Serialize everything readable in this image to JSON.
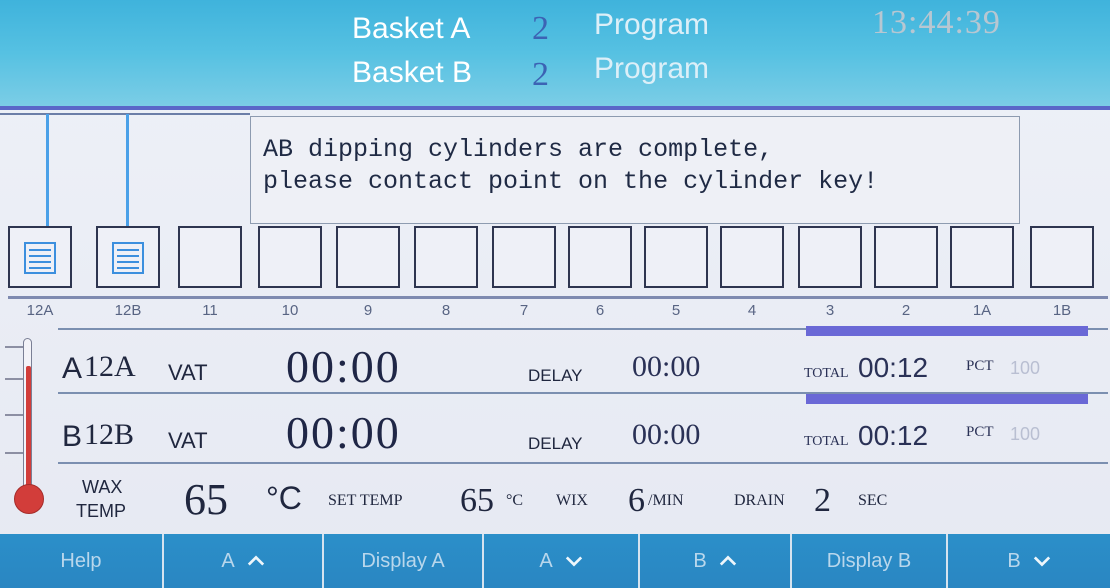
{
  "header": {
    "basket_a_label": "Basket A",
    "basket_a_num": "2",
    "basket_b_label": "Basket B",
    "basket_b_num": "2",
    "program_label": "Program",
    "time": "13:44:39"
  },
  "message": {
    "line1": "AB dipping cylinders are complete,",
    "line2": "please contact point on the cylinder key!"
  },
  "tanks": [
    "12A",
    "12B",
    "11",
    "10",
    "9",
    "8",
    "7",
    "6",
    "5",
    "4",
    "3",
    "2",
    "1A",
    "1B"
  ],
  "row_a": {
    "letter": "A",
    "id": "12A",
    "vat": "VAT",
    "time": "00:00",
    "delay_label": "DELAY",
    "delay": "00:00",
    "total_label": "TOTAL",
    "total": "00:12",
    "pct_label": "PCT",
    "pct": "100"
  },
  "row_b": {
    "letter": "B",
    "id": "12B",
    "vat": "VAT",
    "time": "00:00",
    "delay_label": "DELAY",
    "delay": "00:00",
    "total_label": "TOTAL",
    "total": "00:12",
    "pct_label": "PCT",
    "pct": "100"
  },
  "wax": {
    "label1": "WAX",
    "label2": "TEMP",
    "temp": "65",
    "temp_unit": "°C",
    "set_label": "SET TEMP",
    "set_temp": "65",
    "set_unit": "°C",
    "wix_label": "WIX",
    "wix_value": "6",
    "wix_unit": "/MIN",
    "drain_label": "DRAIN",
    "drain_value": "2",
    "drain_unit": "SEC"
  },
  "buttons": {
    "help": "Help",
    "a_up": "A",
    "display_a": "Display A",
    "a_down": "A",
    "b_up": "B",
    "display_b": "Display B",
    "b_down": "B"
  },
  "colors": {
    "header": "#4bb8df",
    "button": "#2a8ac6",
    "progress": "#6a68d6",
    "thermometer": "#d23d3a",
    "hanger": "#4aa0e8"
  }
}
